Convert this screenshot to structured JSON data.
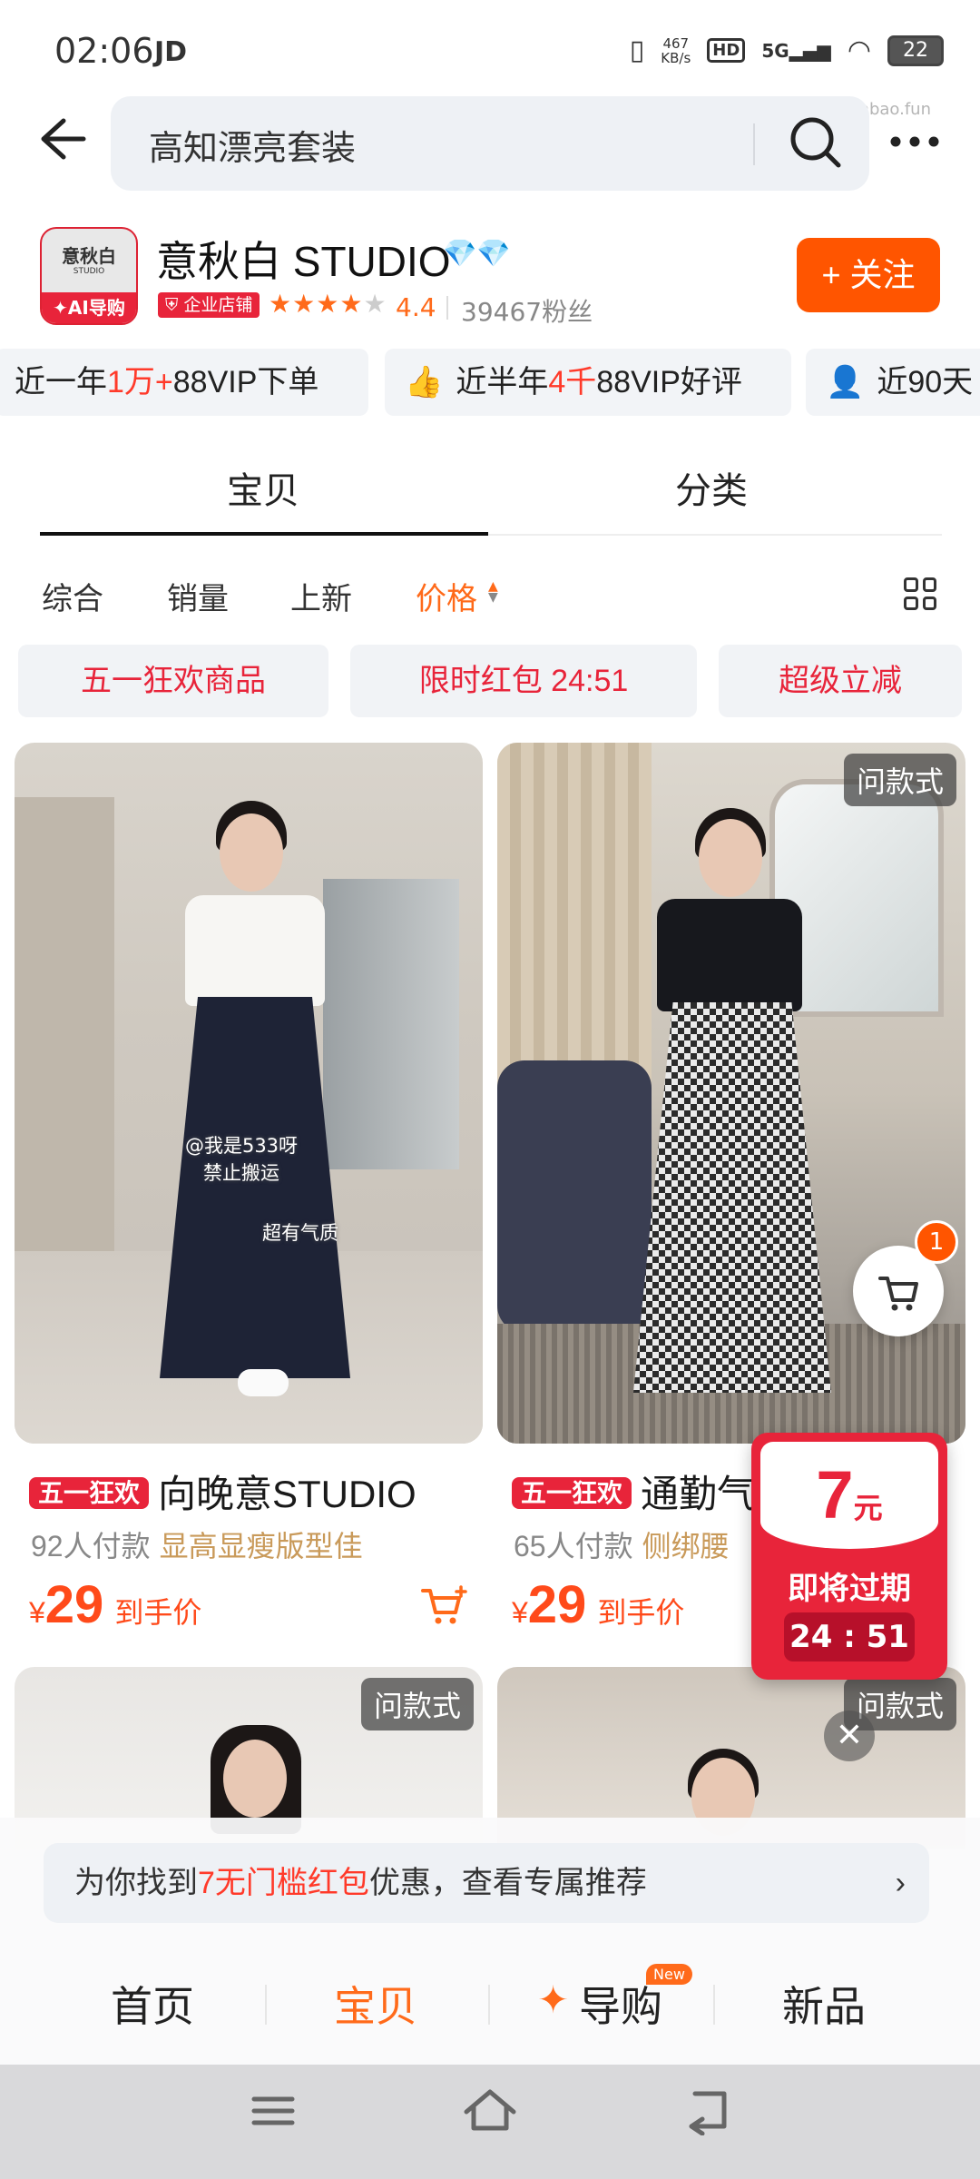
{
  "status_bar": {
    "time": "02:06",
    "carrier": "JD",
    "net_speed_value": "467",
    "net_speed_unit": "KB/s",
    "hd": "HD",
    "signal": "5G",
    "battery": "22"
  },
  "watermark": "线报酷-new.xianbao.fun",
  "search": {
    "value": "高知漂亮套装"
  },
  "shop": {
    "logo_text": "意秋白",
    "logo_sub": "STUDIO",
    "logo_ai": "✦AI导购",
    "name": "意秋白 STUDIO",
    "enterprise_tag": "企业店铺",
    "stars_filled": 4,
    "stars_total": 5,
    "rating": "4.4",
    "fans": "39467粉丝",
    "follow_label": "+ 关注"
  },
  "highlights": [
    {
      "pre": "近一年",
      "hl": "1万+",
      "post": "88VIP下单"
    },
    {
      "pre": "近半年",
      "hl": "4千",
      "post": "88VIP好评"
    },
    {
      "pre": "近90天",
      "hl": "",
      "post": ""
    }
  ],
  "tabs": [
    "宝贝",
    "分类"
  ],
  "sort": [
    "综合",
    "销量",
    "上新",
    "价格"
  ],
  "promos": [
    "五一狂欢商品",
    "限时红包 24:51",
    "超级立减"
  ],
  "products": [
    {
      "tag": "五一狂欢",
      "title": "向晚意STUDIO",
      "paid": "92人付款",
      "feature": "显高显瘦版型佳",
      "currency": "¥",
      "price": "29",
      "price_label": "到手价",
      "img_text_1": "@我是533呀",
      "img_text_2": "禁止搬运",
      "img_text_3": "超有气质"
    },
    {
      "tag": "五一狂欢",
      "title": "通勤气",
      "paid": "65人付款",
      "feature": "侧绑腰",
      "currency": "¥",
      "price": "29",
      "price_label": "到手价",
      "same_tag": "问款式"
    }
  ],
  "row2_tags": [
    "问款式",
    "问款式"
  ],
  "cart_badge": "1",
  "coupon": {
    "amount": "7",
    "unit": "元",
    "expire_label": "即将过期",
    "countdown": "24 : 51"
  },
  "recommend": {
    "pre": "为你找到",
    "hl": "7无门槛红包",
    "post": "优惠，查看专属推荐"
  },
  "bottom_nav": [
    "首页",
    "宝贝",
    "导购",
    "新品"
  ],
  "bottom_nav_new_badge": "New",
  "colors": {
    "accent": "#ff6a1a",
    "brand_red": "#e8243a",
    "follow_button": "#ff5500"
  }
}
